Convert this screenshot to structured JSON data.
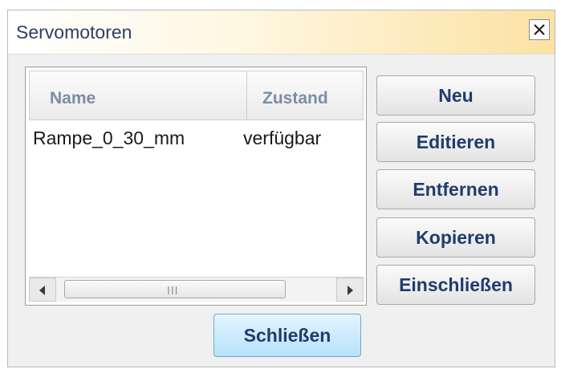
{
  "dialog": {
    "title": "Servomotoren",
    "close_icon": "close-icon"
  },
  "list": {
    "columns": [
      "Name",
      "Zustand"
    ],
    "rows": [
      {
        "name": "Rampe_0_30_mm",
        "state": "verfügbar"
      }
    ],
    "scroll_grip": "III"
  },
  "buttons": {
    "new": "Neu",
    "edit": "Editieren",
    "remove": "Entfernen",
    "copy": "Kopieren",
    "include": "Einschließen",
    "close": "Schließen"
  },
  "colors": {
    "title_gradient_end": "#fbe2a3",
    "primary_button": "#b7e1fb",
    "button_text": "#1f3c6d"
  }
}
